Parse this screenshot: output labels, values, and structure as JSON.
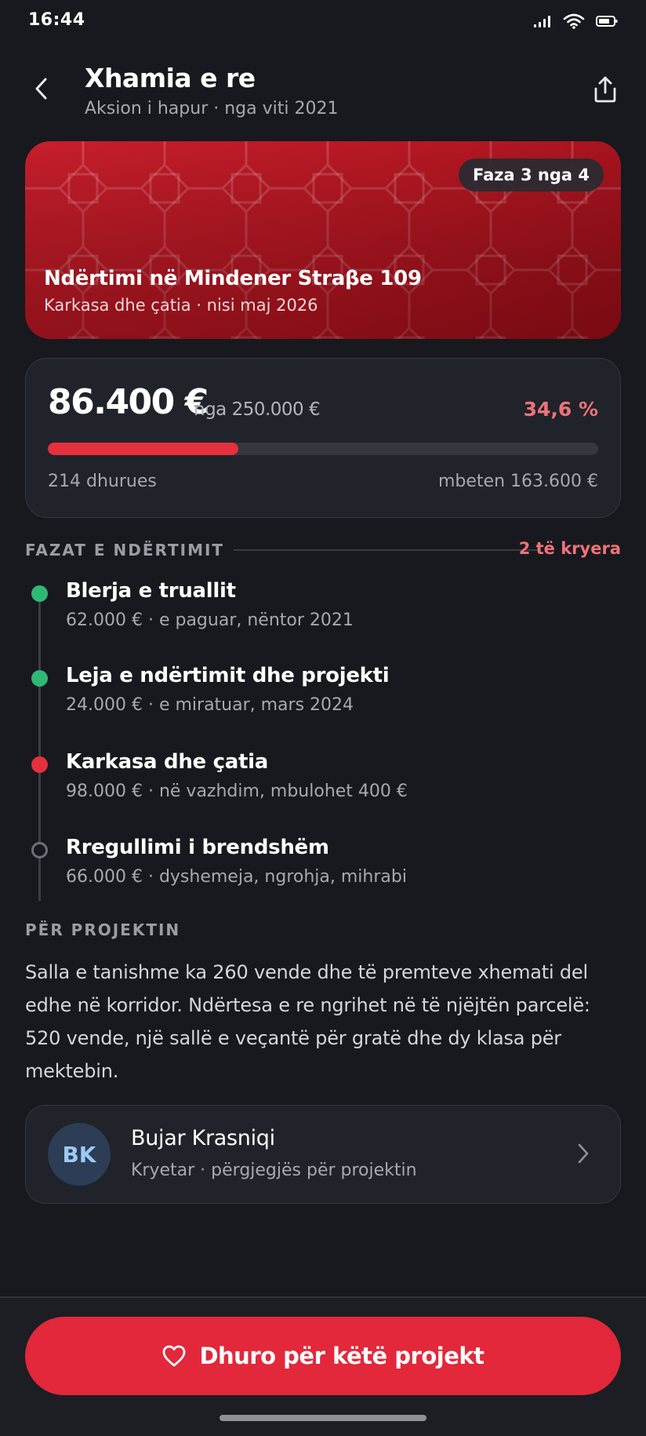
{
  "status_bar": {
    "time": "16:44"
  },
  "header": {
    "title": "Xhamia e re",
    "subtitle": "Aksion i hapur · nga viti 2021"
  },
  "hero": {
    "badge": "Faza 3 nga 4",
    "title": "Ndërtimi në Mindener Straβe 109",
    "subtitle": "Karkasa dhe çatia · nisi maj 2026"
  },
  "progress": {
    "raised": "86.400 €",
    "goal_text": "nga 250.000 €",
    "percent_text": "34,6 %",
    "fraction": 0.346,
    "donors": "214 dhurues",
    "remaining": "mbeten 163.600 €"
  },
  "phases": {
    "section_label": "FAZAT E NDËRTIMIT",
    "done_count": "2 të kryera",
    "items": [
      {
        "title": "Blerja e truallit",
        "desc": "62.000 € · e paguar, nëntor 2021",
        "status": "done"
      },
      {
        "title": "Leja e ndërtimit dhe projekti",
        "desc": "24.000 € · e miratuar, mars 2024",
        "status": "done"
      },
      {
        "title": "Karkasa dhe çatia",
        "desc": "98.000 € · në vazhdim, mbulohet 400 €",
        "status": "active"
      },
      {
        "title": "Rregullimi i brendshëm",
        "desc": "66.000 € · dyshemeja, ngrohja, mihrabi",
        "status": "pending"
      }
    ]
  },
  "about": {
    "section_label": "PËR PROJEKTIN",
    "text": "Salla e tanishme ka 260 vende dhe të premteve xhemati del edhe në korridor. Ndërtesa e re ngrihet në të njëjtën parcelë: 520 vende, një sallë e veçantë për gratë dhe dy klasa për mektebin."
  },
  "contact": {
    "initials": "BK",
    "name": "Bujar Krasniqi",
    "role": "Kryetar · përgjegjës për projektin"
  },
  "cta": {
    "label": "Dhuro për këtë projekt"
  },
  "colors": {
    "accent": "#e2283a",
    "done": "#2fb874",
    "active": "#e5303d",
    "pending": "#6d7078"
  }
}
